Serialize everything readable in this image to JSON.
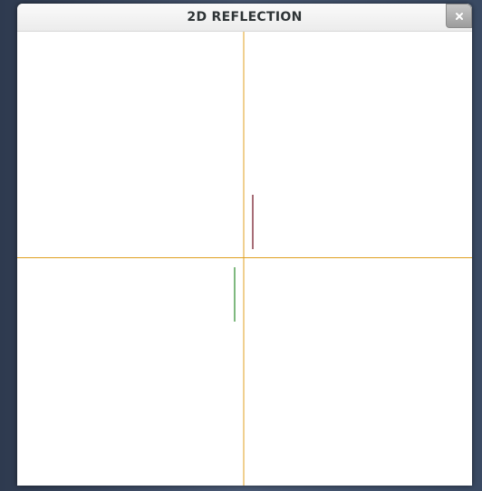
{
  "window": {
    "title": "2D REFLECTION"
  },
  "titlebar": {
    "close_icon": "close-icon"
  },
  "canvas": {
    "axis_color": "#e0a020",
    "object_color": "#6b0a1a",
    "reflection_color": "#2a8a2a"
  }
}
